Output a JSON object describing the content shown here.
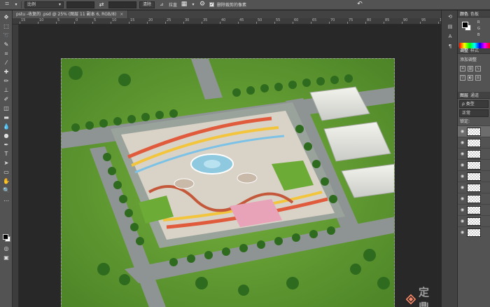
{
  "options_bar": {
    "tool_icon": "crop-icon",
    "ratio_dropdown": "比例",
    "width_value": "",
    "swap_icon": "swap-icon",
    "height_value": "",
    "clear_button": "清除",
    "straighten_label": "拉直",
    "overlay_icon": "grid-overlay-icon",
    "settings_icon": "gear-icon",
    "delete_pixels_checked": true,
    "delete_pixels_label": "删除裁剪的像素",
    "reset_icon": "undo-icon"
  },
  "document": {
    "tab_label": "pstu -收复的 .psd @ 25% (图层 11 副本 6, RGB/8)",
    "close_label": "×"
  },
  "ruler": {
    "h_labels": [
      "15",
      "10",
      "5",
      "0",
      "5",
      "10",
      "15",
      "20",
      "25",
      "30",
      "35",
      "40",
      "45",
      "50",
      "55",
      "60",
      "65",
      "70",
      "75",
      "80",
      "85",
      "90",
      "95",
      "1"
    ]
  },
  "panels": {
    "color_tab": "颜色",
    "swatches_tab": "色板",
    "rgb_labels": [
      "R",
      "G",
      "B"
    ],
    "adjust_tab": "调整",
    "styles_tab": "样式",
    "adjust_title": "添加调整",
    "layers_tab": "图层",
    "channels_tab": "通道",
    "filter_label": "ρ 类型",
    "blend_mode": "正常",
    "lock_label": "锁定:",
    "layer_count": 10
  },
  "watermark": {
    "text": "定 鼎"
  },
  "colors": {
    "ui_bg": "#282828",
    "panel": "#535353",
    "grass": "#5f9a33",
    "road": "#8e9493"
  }
}
